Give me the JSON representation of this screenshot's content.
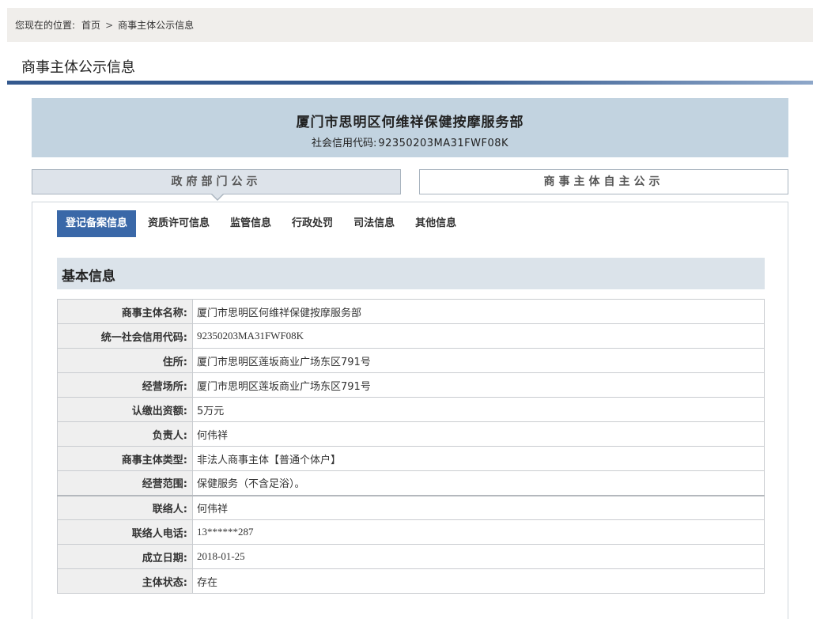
{
  "breadcrumb": {
    "prefix": "您现在的位置:",
    "home": "首页",
    "separator": ">",
    "current": "商事主体公示信息"
  },
  "page_title": "商事主体公示信息",
  "entity": {
    "name": "厦门市思明区何维祥保健按摩服务部",
    "code_label": "社会信用代码:",
    "code_value": "92350203MA31FWF08K"
  },
  "main_tabs": {
    "government": "政府部门公示",
    "self": "商事主体自主公示"
  },
  "sub_tabs": [
    {
      "label": "登记备案信息",
      "active": true
    },
    {
      "label": "资质许可信息",
      "active": false
    },
    {
      "label": "监管信息",
      "active": false
    },
    {
      "label": "行政处罚",
      "active": false
    },
    {
      "label": "司法信息",
      "active": false
    },
    {
      "label": "其他信息",
      "active": false
    }
  ],
  "section_title": "基本信息",
  "rows": [
    {
      "label": "商事主体名称:",
      "value": "厦门市思明区何维祥保健按摩服务部"
    },
    {
      "label": "统一社会信用代码:",
      "value": "92350203MA31FWF08K"
    },
    {
      "label": "住所:",
      "value": "厦门市思明区莲坂商业广场东区791号"
    },
    {
      "label": "经营场所:",
      "value": "厦门市思明区莲坂商业广场东区791号"
    },
    {
      "label": "认缴出资额:",
      "value": "5万元"
    },
    {
      "label": "负责人:",
      "value": "何伟祥"
    },
    {
      "label": "商事主体类型:",
      "value": "非法人商事主体【普通个体户】"
    },
    {
      "label": "经营范围:",
      "value": "保健服务（不含足浴）。"
    },
    {
      "label": "联络人:",
      "value": "何伟祥"
    },
    {
      "label": "联络人电话:",
      "value": "13******287"
    },
    {
      "label": "成立日期:",
      "value": "2018-01-25"
    },
    {
      "label": "主体状态:",
      "value": "存在"
    }
  ],
  "colors": {
    "active_tab": "#3a68a8",
    "header_band": "#c2d3e0",
    "title_rule": "#34598e"
  }
}
